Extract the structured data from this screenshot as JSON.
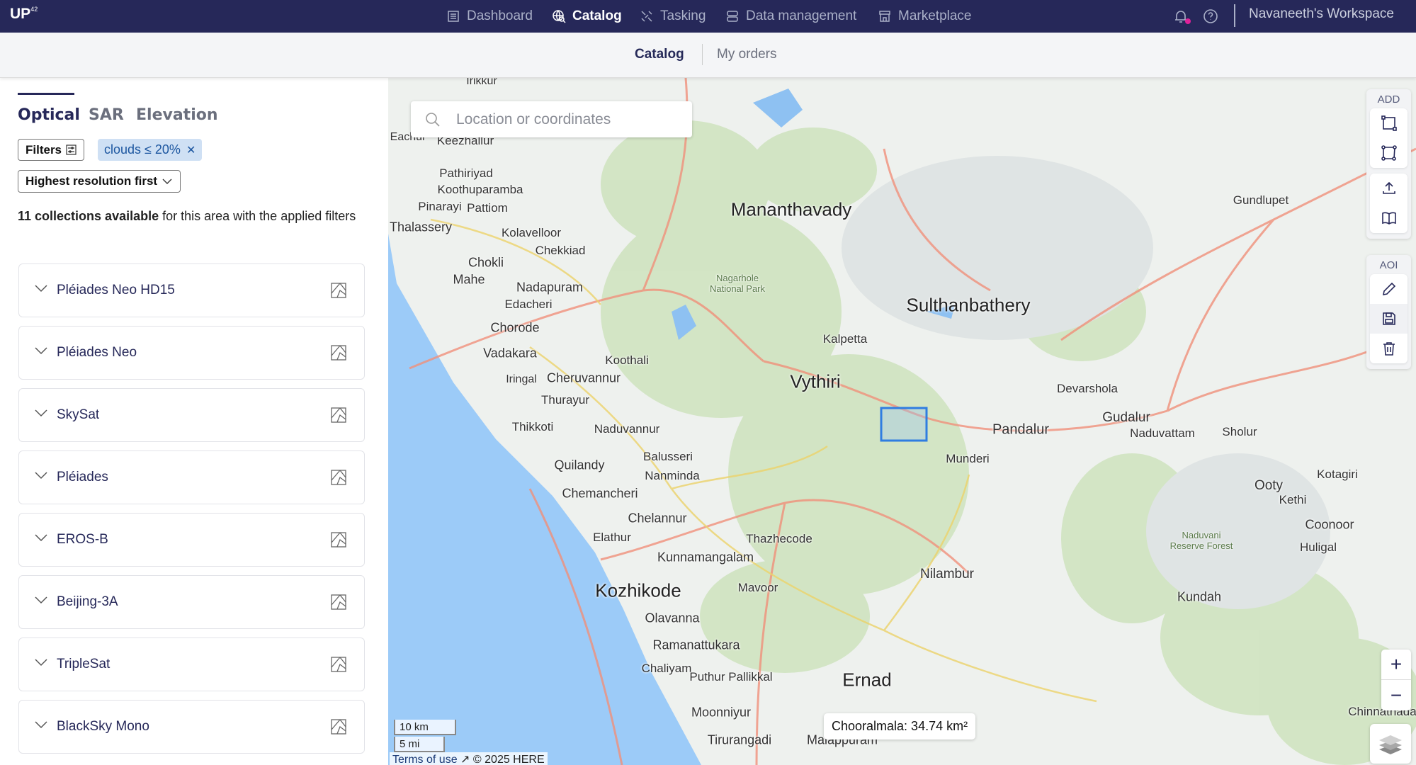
{
  "app": {
    "logo": "UP",
    "logo_sup": "42",
    "workspace": "Navaneeth's Workspace",
    "notification_color": "#e0219a"
  },
  "nav": [
    {
      "label": "Dashboard",
      "icon": "dashboard-icon"
    },
    {
      "label": "Catalog",
      "icon": "globe-search-icon",
      "active": true
    },
    {
      "label": "Tasking",
      "icon": "satellite-icon"
    },
    {
      "label": "Data management",
      "icon": "database-icon"
    },
    {
      "label": "Marketplace",
      "icon": "store-icon"
    }
  ],
  "subnav": {
    "catalog": "Catalog",
    "orders": "My orders"
  },
  "panel": {
    "tabs": [
      "Optical",
      "SAR",
      "Elevation"
    ],
    "filters_label": "Filters",
    "chip": "clouds ≤ 20%",
    "sort": "Highest resolution first",
    "count_bold": "11 collections available",
    "count_rest": " for this area with the applied filters",
    "collections": [
      "Pléiades Neo HD15",
      "Pléiades Neo",
      "SkySat",
      "Pléiades",
      "EROS-B",
      "Beijing-3A",
      "TripleSat",
      "BlackSky Mono"
    ]
  },
  "map": {
    "search_placeholder": "Location or coordinates",
    "toolbar": {
      "add": "ADD",
      "aoi": "AOI"
    },
    "zoom_in": "+",
    "zoom_out": "−",
    "scale_km": "10 km",
    "scale_mi": "5 mi",
    "terms": "Terms of use",
    "copyright": "© 2025 HERE",
    "aoi_tooltip": "Chooralmala: 34.74 km²",
    "aoi_color": "#2f7de1",
    "labels": [
      "Mananthavady",
      "Sulthanbathery",
      "Vythiri",
      "Kozhikode",
      "Ernad",
      "Pandalur",
      "Gudalur",
      "Ooty",
      "Nilambur",
      "Kalpetta",
      "Thalassery",
      "Mahe",
      "Vadakara",
      "Chokli",
      "Nadapuram",
      "Chorode",
      "Cheruvannur",
      "Quilandy",
      "Chemancheri",
      "Chelannur",
      "Kunnamangalam",
      "Olavanna",
      "Ramanattukara",
      "Moonniyur",
      "Tirurangadi",
      "Malappuram",
      "Mavoor",
      "Thazhecode",
      "Nanminda",
      "Balusseri",
      "Naduvannur",
      "Thikkoti",
      "Thurayur",
      "Koothali",
      "Kolavelloor",
      "Chekkiad",
      "Edacheri",
      "Pattiom",
      "Pinarayi",
      "Koothuparamba",
      "Pathiriyad",
      "Keezhallur",
      "Eachur",
      "Irikkur",
      "Munderi",
      "Devarshola",
      "Naduvattam",
      "Sholur",
      "Kethi",
      "Coonoor",
      "Huligal",
      "Kotagiri",
      "Kundah",
      "Gundlupet",
      "Chaliyam",
      "Puthur Pallikkal",
      "Elathur",
      "Iringal",
      "Chinnathadagam",
      "Nagarhole National Park",
      "Naduvani Reserve Forest"
    ]
  }
}
